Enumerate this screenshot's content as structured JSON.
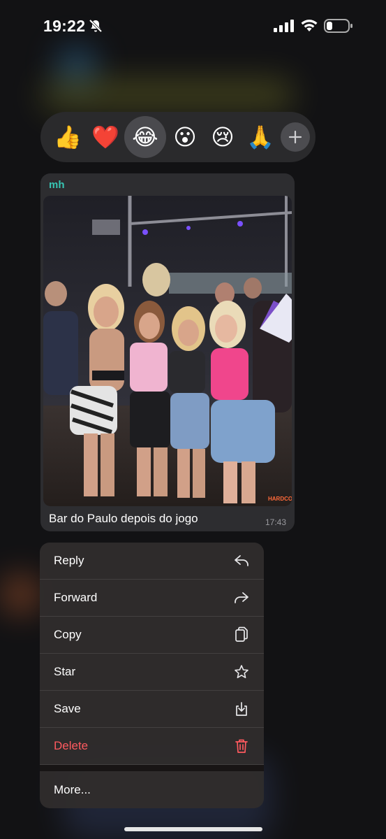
{
  "status_bar": {
    "time": "19:22",
    "icons": [
      "bell-slash-icon",
      "cellular-signal-icon",
      "wifi-icon",
      "battery-icon"
    ]
  },
  "reactions": {
    "items": [
      {
        "emoji": "👍",
        "icon": "thumbs-up-icon"
      },
      {
        "emoji": "❤️",
        "icon": "heart-icon"
      },
      {
        "emoji": "😂",
        "icon": "tears-of-joy-icon",
        "selected": true
      },
      {
        "emoji": "😮",
        "icon": "surprised-face-icon"
      },
      {
        "emoji": "😢",
        "icon": "crying-face-icon"
      },
      {
        "emoji": "🙏",
        "icon": "folded-hands-icon"
      }
    ],
    "more_icon": "plus-icon"
  },
  "message": {
    "sender": "mh",
    "caption": "Bar do Paulo depois do jogo",
    "time": "17:43",
    "photo_watermark": "HARDCORE"
  },
  "menu": {
    "items": [
      {
        "label": "Reply",
        "icon": "reply-icon"
      },
      {
        "label": "Forward",
        "icon": "forward-icon"
      },
      {
        "label": "Copy",
        "icon": "copy-icon"
      },
      {
        "label": "Star",
        "icon": "star-icon"
      },
      {
        "label": "Save",
        "icon": "save-icon"
      },
      {
        "label": "Delete",
        "icon": "trash-icon",
        "destructive": true
      }
    ],
    "more_label": "More..."
  },
  "colors": {
    "sender": "#37c6b4",
    "destructive": "#ff5a5f",
    "bubble": "#2d2d30",
    "menu": "#302c2c"
  }
}
